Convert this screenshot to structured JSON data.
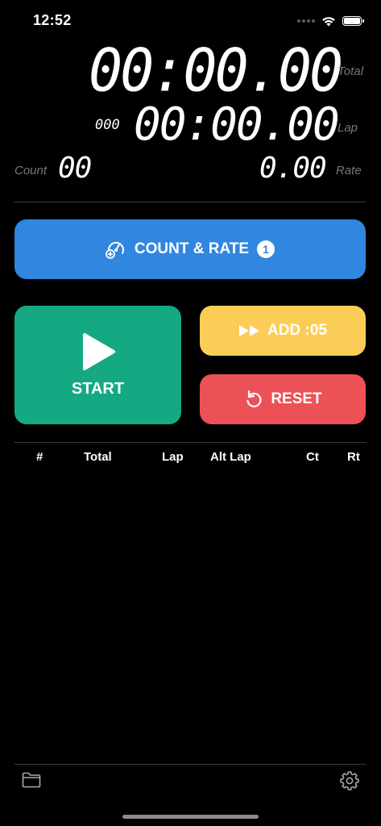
{
  "status_bar": {
    "time": "12:52"
  },
  "display": {
    "total": "00:00.00",
    "total_label": "Total",
    "lap_prefix": "000",
    "lap": "00:00.00",
    "lap_label": "Lap",
    "count_label": "Count",
    "count": "00",
    "rate": "0.00",
    "rate_label": "Rate"
  },
  "buttons": {
    "count_rate_label": "COUNT & RATE",
    "count_rate_badge": "1",
    "start_label": "START",
    "add_label": "ADD :05",
    "reset_label": "RESET"
  },
  "table": {
    "columns": [
      "#",
      "Total",
      "Lap",
      "Alt Lap",
      "Ct",
      "Rt"
    ]
  },
  "colors": {
    "count_rate": "#3186e0",
    "start": "#14a982",
    "add": "#fccd56",
    "reset": "#ec5157"
  },
  "icons": {
    "count_rate_icon": "gauge-plus-icon",
    "start_icon": "play-icon",
    "add_icon": "fast-forward-icon",
    "reset_icon": "undo-icon",
    "bottom_left": "folder-icon",
    "bottom_right": "gear-icon"
  }
}
